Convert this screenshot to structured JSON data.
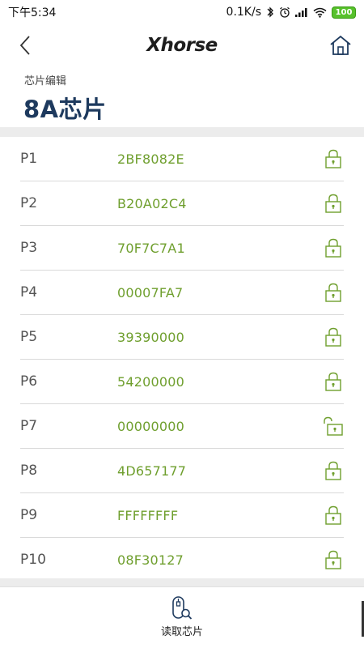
{
  "status_bar": {
    "time": "下午5:34",
    "network_speed": "0.1K/s",
    "battery": "100"
  },
  "header": {
    "logo_text": "Xhorse"
  },
  "page": {
    "subtitle": "芯片编辑",
    "title": "8A芯片"
  },
  "pages": [
    {
      "label": "P1",
      "value": "2BF8082E",
      "locked": true
    },
    {
      "label": "P2",
      "value": "B20A02C4",
      "locked": true
    },
    {
      "label": "P3",
      "value": "70F7C7A1",
      "locked": true
    },
    {
      "label": "P4",
      "value": "00007FA7",
      "locked": true
    },
    {
      "label": "P5",
      "value": "39390000",
      "locked": true
    },
    {
      "label": "P6",
      "value": "54200000",
      "locked": true
    },
    {
      "label": "P7",
      "value": "00000000",
      "locked": false
    },
    {
      "label": "P8",
      "value": "4D657177",
      "locked": true
    },
    {
      "label": "P9",
      "value": "FFFFFFFF",
      "locked": true
    },
    {
      "label": "P10",
      "value": "08F30127",
      "locked": true
    }
  ],
  "bottom_bar": {
    "read_chip_label": "读取芯片"
  },
  "icons": {
    "back": "chevron-left-icon",
    "home": "home-icon",
    "lock": "lock-icon",
    "unlock": "unlock-icon",
    "read_chip": "chip-search-icon"
  },
  "colors": {
    "title": "#1e3a5e",
    "value_green": "#6f9f2e",
    "lock_green": "#6f9f2e",
    "home_blue": "#1e3a5e"
  }
}
